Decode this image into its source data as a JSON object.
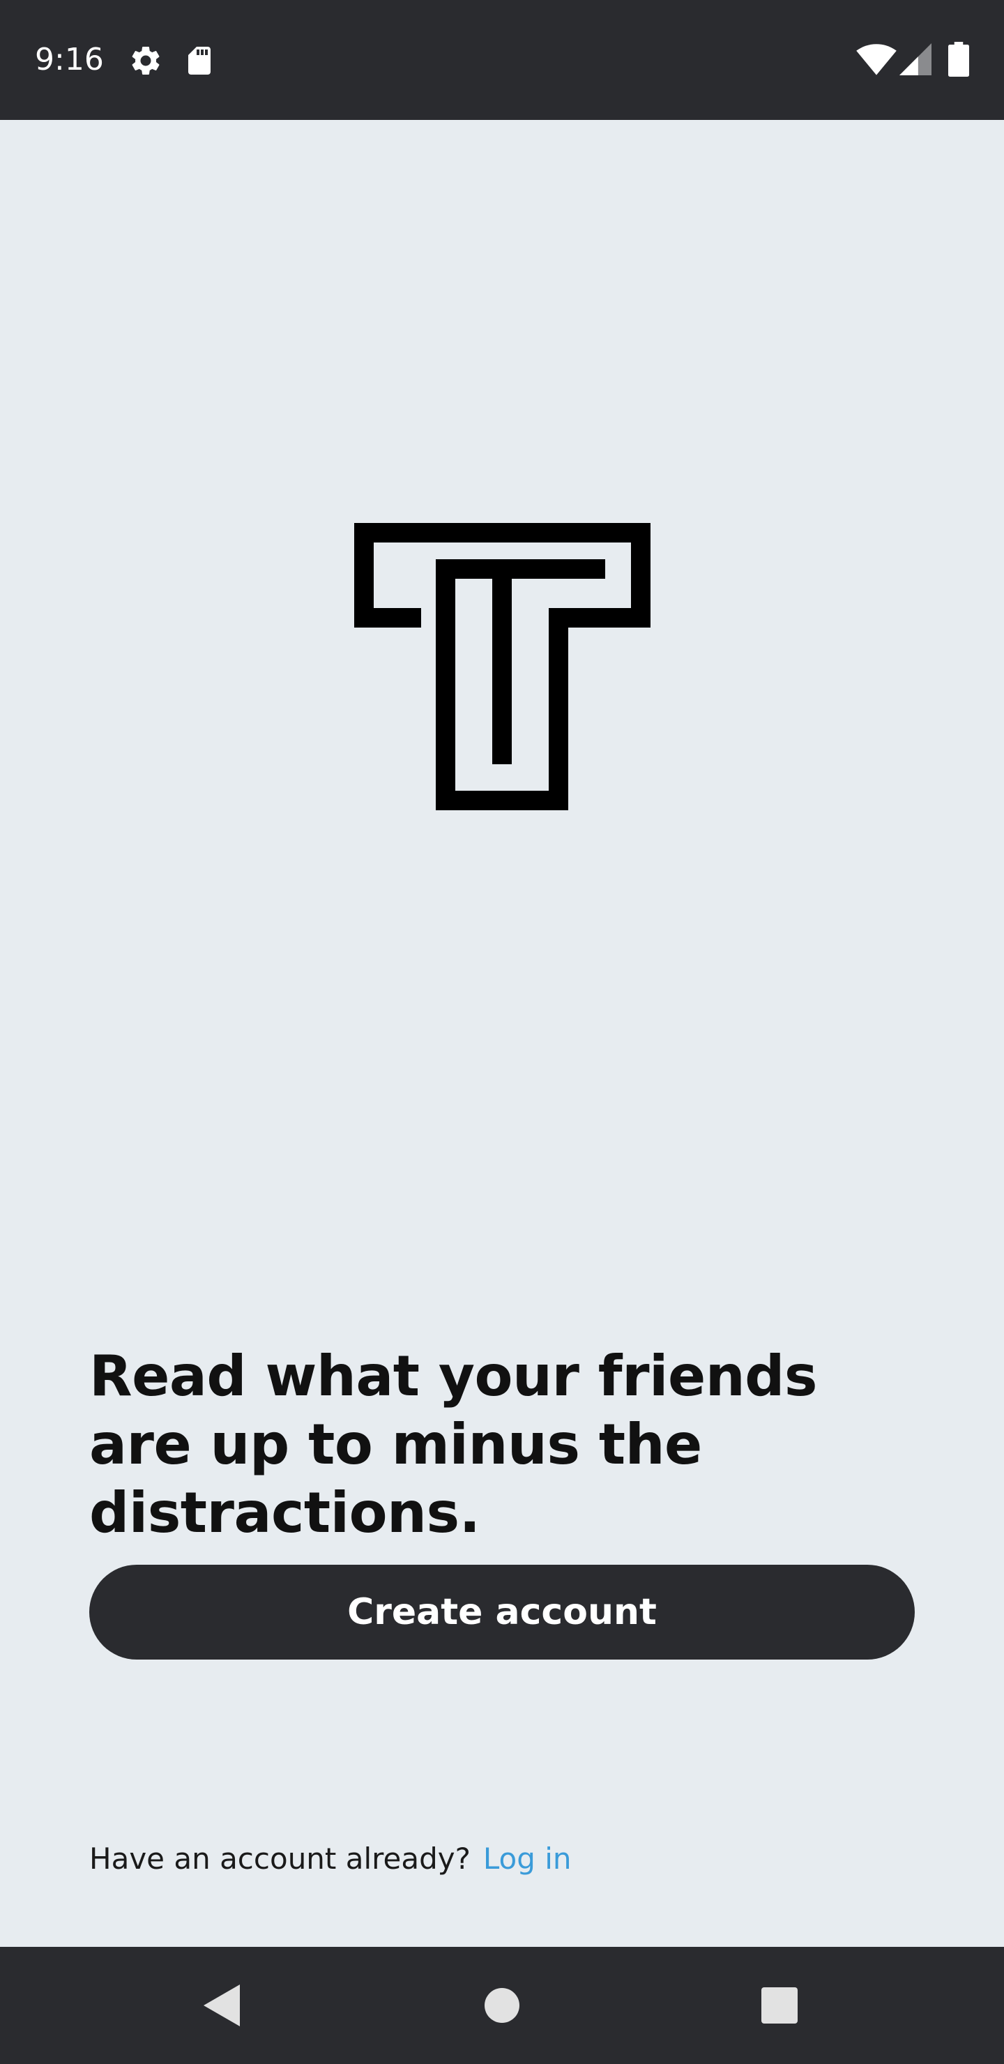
{
  "status_bar": {
    "time": "9:16",
    "icons": [
      "settings-icon",
      "sd-card-icon",
      "wifi-icon",
      "cellular-signal-icon",
      "battery-icon"
    ]
  },
  "logo": {
    "icon": "t-maze-logo-icon"
  },
  "onboarding": {
    "headline": "Read what your friends are up to minus the distractions.",
    "create_account_label": "Create account",
    "login_prompt": "Have an account already?",
    "login_link": "Log in"
  },
  "nav_bar": {
    "icons": [
      "back-triangle-icon",
      "home-circle-icon",
      "recents-square-icon"
    ]
  },
  "colors": {
    "background": "#e7ecf0",
    "bar_dark": "#2a2b2f",
    "text": "#111111",
    "link": "#3a9bd9",
    "button_text": "#ffffff"
  }
}
